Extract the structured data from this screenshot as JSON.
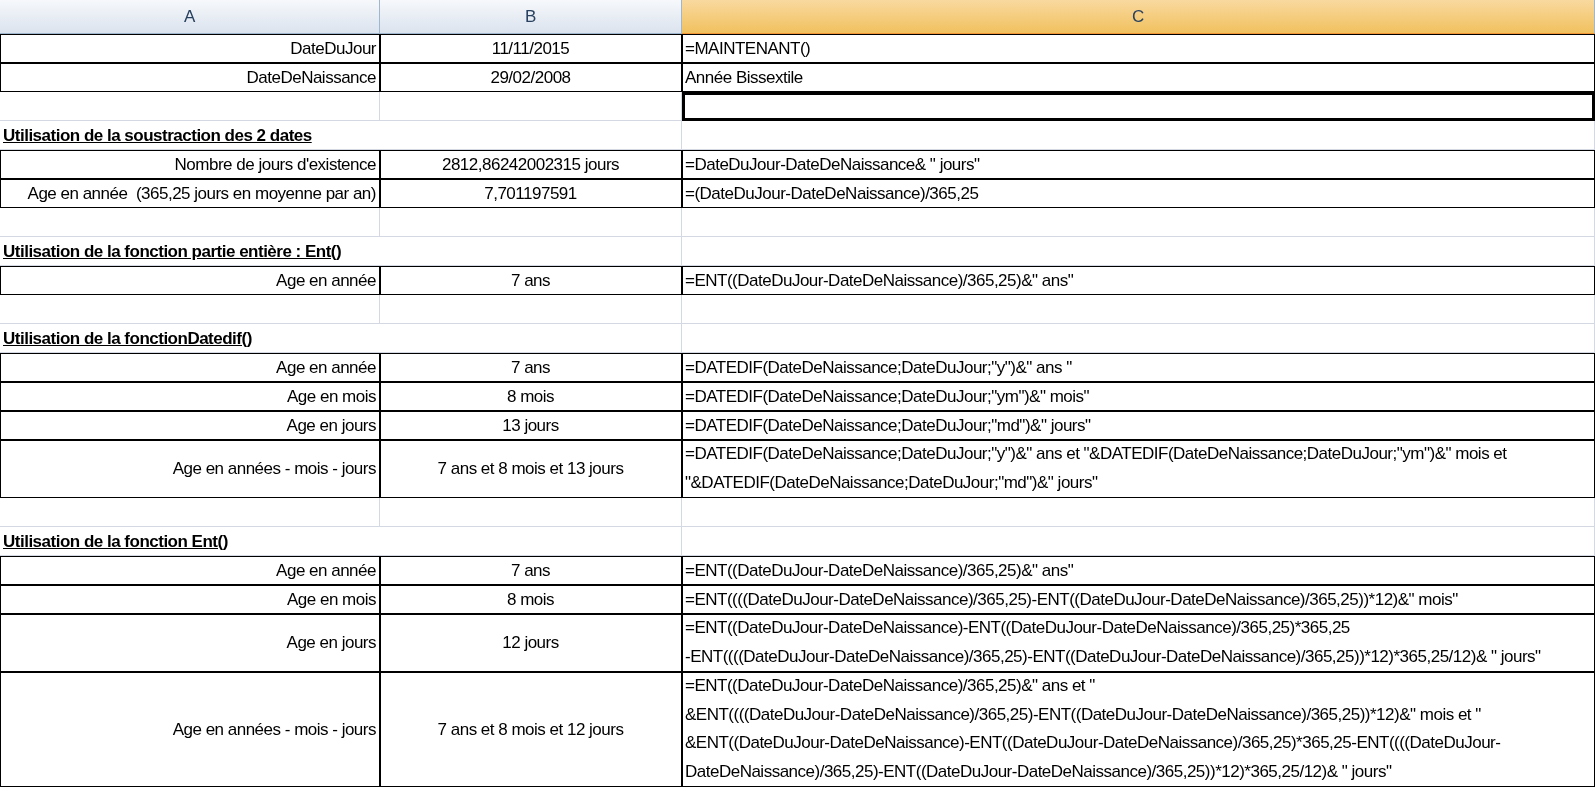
{
  "columns": [
    {
      "label": "A",
      "selected": false
    },
    {
      "label": "B",
      "selected": false
    },
    {
      "label": "C",
      "selected": true
    }
  ],
  "rows": [
    {
      "kind": "data",
      "selected": false,
      "label": "DateDuJour",
      "value": "11/11/2015",
      "formula": [
        "=MAINTENANT()"
      ]
    },
    {
      "kind": "data",
      "selected": false,
      "label": "DateDeNaissance",
      "value": "29/02/2008",
      "formula": [
        "Année Bissextile"
      ]
    },
    {
      "kind": "empty",
      "selected": true
    },
    {
      "kind": "heading",
      "selected": false,
      "label": "Utilisation de la soustraction des 2 dates"
    },
    {
      "kind": "data",
      "selected": false,
      "label": "Nombre de jours d'existence",
      "value": "2812,86242002315 jours",
      "formula": [
        "=DateDuJour-DateDeNaissance& \" jours\""
      ]
    },
    {
      "kind": "data",
      "selected": false,
      "label": "Age en année  (365,25 jours en moyenne par an)",
      "value": "7,701197591",
      "formula": [
        "=(DateDuJour-DateDeNaissance)/365,25"
      ]
    },
    {
      "kind": "empty",
      "selected": false
    },
    {
      "kind": "heading",
      "selected": false,
      "label": "Utilisation de la fonction partie entière : Ent()"
    },
    {
      "kind": "data",
      "selected": false,
      "label": "Age en année",
      "value": "7 ans",
      "formula": [
        "=ENT((DateDuJour-DateDeNaissance)/365,25)&\" ans\""
      ]
    },
    {
      "kind": "empty",
      "selected": false
    },
    {
      "kind": "heading",
      "selected": false,
      "label": "Utilisation de la fonctionDatedif()"
    },
    {
      "kind": "data",
      "selected": false,
      "label": "Age en année",
      "value": "7 ans",
      "formula": [
        "=DATEDIF(DateDeNaissance;DateDuJour;\"y\")&\" ans \""
      ]
    },
    {
      "kind": "data",
      "selected": false,
      "label": "Age en mois",
      "value": "8 mois",
      "formula": [
        "=DATEDIF(DateDeNaissance;DateDuJour;\"ym\")&\" mois\""
      ]
    },
    {
      "kind": "data",
      "selected": false,
      "label": "Age en jours",
      "value": "13 jours",
      "formula": [
        "=DATEDIF(DateDeNaissance;DateDuJour;\"md\")&\" jours\""
      ]
    },
    {
      "kind": "data",
      "selected": false,
      "label": "Age en années - mois - jours",
      "value": "7 ans et 8 mois et 13 jours",
      "formula": [
        "=DATEDIF(DateDeNaissance;DateDuJour;\"y\")&\" ans et \"&DATEDIF(DateDeNaissance;DateDuJour;\"ym\")&\" mois et",
        "\"&DATEDIF(DateDeNaissance;DateDuJour;\"md\")&\" jours\""
      ]
    },
    {
      "kind": "empty",
      "selected": false
    },
    {
      "kind": "heading",
      "selected": false,
      "label": "Utilisation de la fonction Ent()"
    },
    {
      "kind": "data",
      "selected": false,
      "label": "Age en année",
      "value": "7 ans",
      "formula": [
        "=ENT((DateDuJour-DateDeNaissance)/365,25)&\" ans\""
      ]
    },
    {
      "kind": "data",
      "selected": false,
      "label": "Age en mois",
      "value": "8 mois",
      "formula": [
        "=ENT((((DateDuJour-DateDeNaissance)/365,25)-ENT((DateDuJour-DateDeNaissance)/365,25))*12)&\" mois\""
      ]
    },
    {
      "kind": "data",
      "selected": false,
      "label": "Age en jours",
      "value": "12 jours",
      "formula": [
        "=ENT((DateDuJour-DateDeNaissance)-ENT((DateDuJour-DateDeNaissance)/365,25)*365,25",
        "-ENT((((DateDuJour-DateDeNaissance)/365,25)-ENT((DateDuJour-DateDeNaissance)/365,25))*12)*365,25/12)& \" jours\""
      ]
    },
    {
      "kind": "data",
      "selected": false,
      "label": "Age en années - mois - jours",
      "value": "7 ans et 8 mois et 12 jours",
      "formula": [
        "=ENT((DateDuJour-DateDeNaissance)/365,25)&\" ans et \"",
        "&ENT((((DateDuJour-DateDeNaissance)/365,25)-ENT((DateDuJour-DateDeNaissance)/365,25))*12)&\" mois et \"",
        "&ENT((DateDuJour-DateDeNaissance)-ENT((DateDuJour-DateDeNaissance)/365,25)*365,25-ENT((((DateDuJour-",
        "DateDeNaissance)/365,25)-ENT((DateDuJour-DateDeNaissance)/365,25))*12)*365,25/12)& \" jours\""
      ]
    }
  ]
}
